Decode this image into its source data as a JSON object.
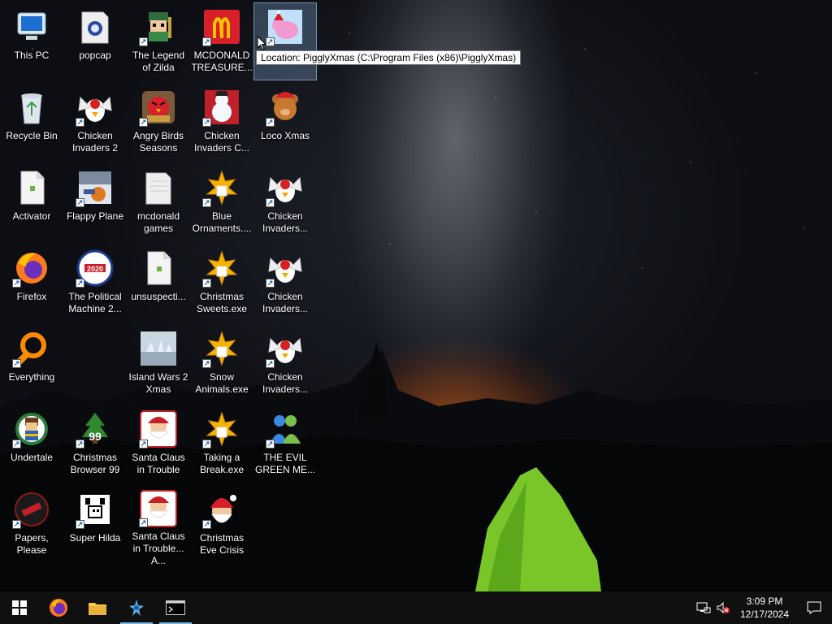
{
  "tooltip": "Location: PigglyXmas (C:\\Program Files (x86)\\PigglyXmas)",
  "columns": [
    [
      {
        "label": "This PC",
        "icon": "this-pc-icon",
        "shortcut": false
      },
      {
        "label": "Recycle Bin",
        "icon": "recycle-bin-icon",
        "shortcut": false
      },
      {
        "label": "Activator",
        "icon": "file-icon",
        "shortcut": false
      },
      {
        "label": "Firefox",
        "icon": "firefox-icon",
        "shortcut": true
      },
      {
        "label": "Everything",
        "icon": "everything-icon",
        "shortcut": true
      },
      {
        "label": "Undertale",
        "icon": "undertale-icon",
        "shortcut": true
      },
      {
        "label": "Papers, Please",
        "icon": "papers-please-icon",
        "shortcut": true
      }
    ],
    [
      {
        "label": "popcap",
        "icon": "popcap-folder-icon",
        "shortcut": false
      },
      {
        "label": "Chicken Invaders 2",
        "icon": "chicken-invaders-icon",
        "shortcut": true
      },
      {
        "label": "Flappy Plane",
        "icon": "flappy-plane-icon",
        "shortcut": true
      },
      {
        "label": "The Political Machine 2...",
        "icon": "political-machine-icon",
        "shortcut": true
      },
      {
        "label": "",
        "icon": "",
        "shortcut": false
      },
      {
        "label": "Christmas Browser 99",
        "icon": "christmas-tree-icon",
        "shortcut": true
      },
      {
        "label": "Super Hilda",
        "icon": "super-hilda-icon",
        "shortcut": true
      }
    ],
    [
      {
        "label": "The Legend of Zilda",
        "icon": "zilda-icon",
        "shortcut": true
      },
      {
        "label": "Angry Birds Seasons",
        "icon": "angry-birds-icon",
        "shortcut": true
      },
      {
        "label": "mcdonald games",
        "icon": "folder-icon",
        "shortcut": false
      },
      {
        "label": "unsuspecti...",
        "icon": "file-icon",
        "shortcut": false
      },
      {
        "label": "Island Wars 2 Xmas",
        "icon": "island-wars-icon",
        "shortcut": false
      },
      {
        "label": "Santa Claus in Trouble",
        "icon": "santa-trouble-icon",
        "shortcut": true
      },
      {
        "label": "Santa Claus in Trouble... A...",
        "icon": "santa-trouble-icon",
        "shortcut": true
      }
    ],
    [
      {
        "label": "MCDONALD TREASURE...",
        "icon": "mcdonalds-icon",
        "shortcut": true
      },
      {
        "label": "Chicken Invaders C...",
        "icon": "snowman-icon",
        "shortcut": true
      },
      {
        "label": "Blue Ornaments....",
        "icon": "gift-icon",
        "shortcut": true
      },
      {
        "label": "Christmas Sweets.exe",
        "icon": "gift-icon",
        "shortcut": true
      },
      {
        "label": "Snow Animals.exe",
        "icon": "gift-icon",
        "shortcut": true
      },
      {
        "label": "Taking a Break.exe",
        "icon": "gift-icon",
        "shortcut": true
      },
      {
        "label": "Christmas Eve Crisis",
        "icon": "santa-icon",
        "shortcut": true
      }
    ],
    [
      {
        "label": "",
        "icon": "piggly-xmas-icon",
        "shortcut": true,
        "selected": true
      },
      {
        "label": "Loco Xmas",
        "icon": "teddy-bear-icon",
        "shortcut": true
      },
      {
        "label": "Chicken Invaders...",
        "icon": "chicken-invaders-icon",
        "shortcut": true
      },
      {
        "label": "Chicken Invaders...",
        "icon": "chicken-invaders-icon",
        "shortcut": true
      },
      {
        "label": "Chicken Invaders...",
        "icon": "chicken-invaders-icon",
        "shortcut": true
      },
      {
        "label": "THE EVIL GREEN ME...",
        "icon": "messenger-icon",
        "shortcut": true
      }
    ]
  ],
  "taskbar": {
    "apps": [
      "windows-start-icon",
      "firefox-icon",
      "file-explorer-icon",
      "app-icon",
      "terminal-icon"
    ],
    "time": "3:09 PM",
    "date": "12/17/2024"
  },
  "colors": {
    "taskbar": "#101010",
    "accent": "#76b9ed",
    "tent": "#7fd12a"
  }
}
